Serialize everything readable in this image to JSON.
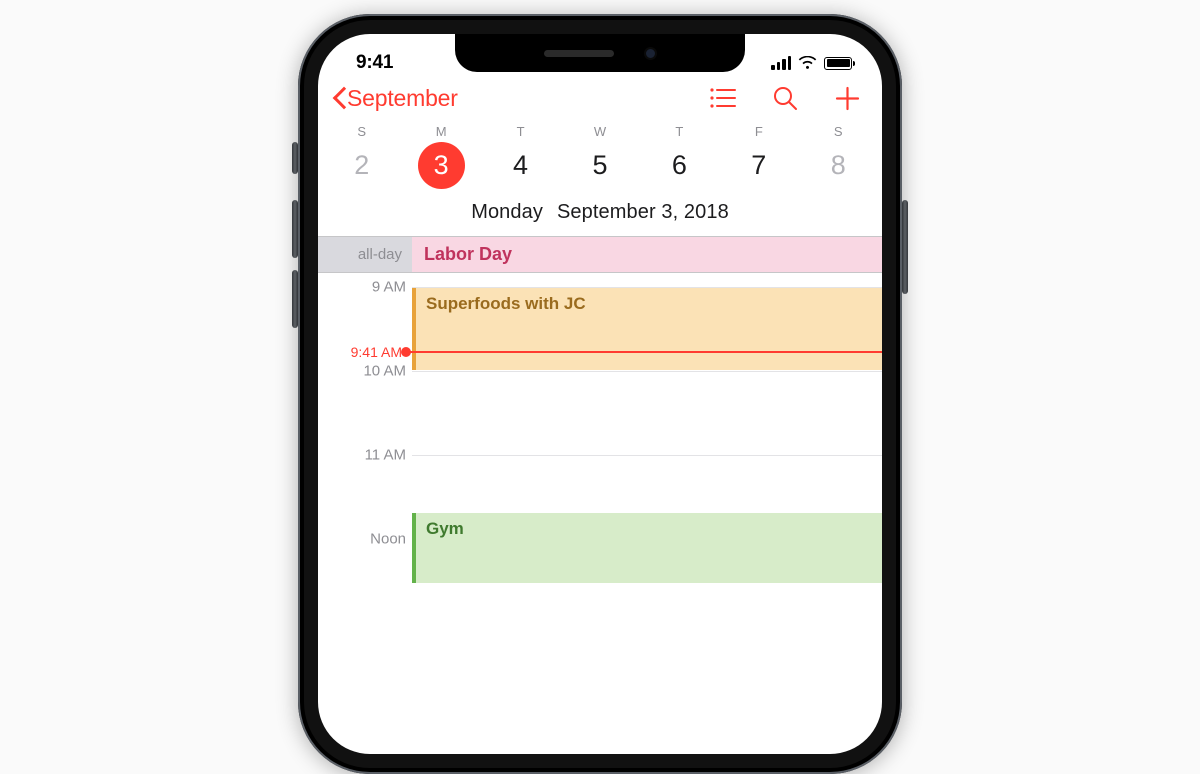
{
  "status": {
    "time": "9:41"
  },
  "nav": {
    "back_label": "September"
  },
  "week": {
    "days_short": [
      "S",
      "M",
      "T",
      "W",
      "T",
      "F",
      "S"
    ],
    "dates": [
      "2",
      "3",
      "4",
      "5",
      "6",
      "7",
      "8"
    ],
    "selected_index": 1
  },
  "date_title": {
    "dow": "Monday",
    "full": "September 3, 2018"
  },
  "allday": {
    "label": "all-day",
    "event": "Labor Day"
  },
  "hours": {
    "h9": "9 AM",
    "h10": "10 AM",
    "h11": "11 AM",
    "h12": "Noon"
  },
  "now": {
    "label": "9:41 AM"
  },
  "events": {
    "e1": "Superfoods with JC",
    "e2": "Gym"
  }
}
